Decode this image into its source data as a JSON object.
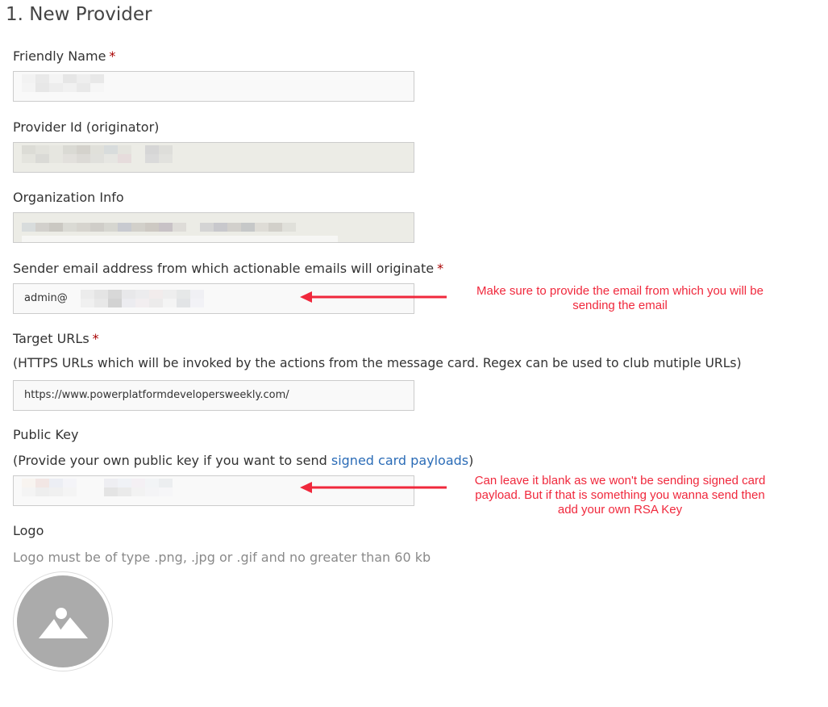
{
  "page": {
    "title": "1. New Provider"
  },
  "fields": {
    "friendly_name": {
      "label": "Friendly Name",
      "required": "*",
      "value": ""
    },
    "provider_id": {
      "label": "Provider Id (originator)",
      "value": ""
    },
    "organization_info": {
      "label": "Organization Info",
      "value": ""
    },
    "sender_email": {
      "label": "Sender email address from which actionable emails will originate",
      "required": "*",
      "value": "admin@"
    },
    "target_urls": {
      "label": "Target URLs",
      "required": "*",
      "hint": "(HTTPS URLs which will be invoked by the actions from the message card. Regex can be used to club mutiple URLs)",
      "value": "https://www.powerplatformdevelopersweekly.com/"
    },
    "public_key": {
      "label": "Public Key",
      "hint_prefix": "(Provide your own public key if you want to send ",
      "hint_link": "signed card payloads",
      "hint_suffix": ")",
      "value": ""
    },
    "logo": {
      "label": "Logo",
      "hint": "Logo must be of type .png, .jpg or .gif and no greater than 60 kb",
      "icon": "image-placeholder-icon"
    }
  },
  "annotations": {
    "email_note_line1": "Make sure to provide the email from which you will be",
    "email_note_line2": "sending the email",
    "key_note_line1": "Can leave it blank as we won't be sending signed card",
    "key_note_line2": "payload. But if that is something you wanna send then",
    "key_note_line3": "add your own RSA Key"
  },
  "colors": {
    "annotation": "#f0283c",
    "required": "#a80000",
    "link": "#2b6cb7",
    "readonly_field": "#ecece6",
    "logo_placeholder": "#ababab"
  }
}
